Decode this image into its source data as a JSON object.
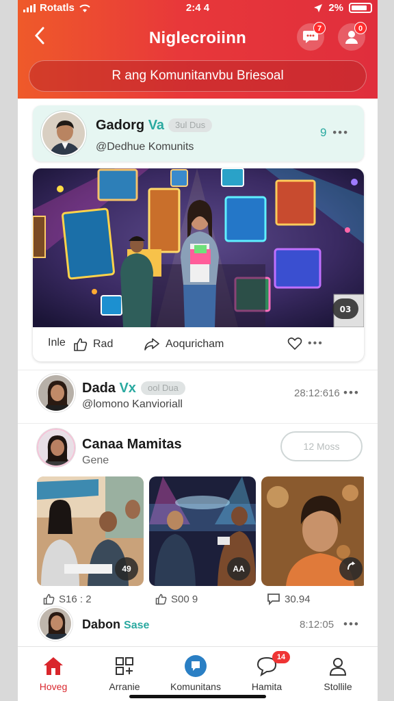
{
  "status_bar": {
    "carrier": "Rotatls",
    "time": "2:4 ​4",
    "battery_text": "2%"
  },
  "header": {
    "back_icon": "chevron-left-icon",
    "title": "Niglecroiinn",
    "chat_badge": "7",
    "profile_badge": "0",
    "search_text": "R ang Komunitanvbu Briesoal"
  },
  "feed": {
    "featured": {
      "author": "Gadorg",
      "tag": "Va",
      "pill": "3ul Dus",
      "handle": "@Dedhue Komunits",
      "meta": "9",
      "actions": {
        "first": "Inle",
        "second": "Rad",
        "third": "Aoquricham"
      },
      "image_badge": "03"
    },
    "post2": {
      "author": "Dada",
      "tag": "Vx",
      "pill": "ool Dua",
      "handle": "@lomono Kanvioriall",
      "timestamp": "28:12:616"
    },
    "post3": {
      "author": "Canaa Mamitas",
      "subtitle": "Gene",
      "follow_label": "12 Moss"
    },
    "thumbnails": [
      {
        "badge": "49",
        "meta": "S16 : 2"
      },
      {
        "badge": "AA",
        "meta": "S00 9"
      },
      {
        "badge": "",
        "meta": "30.94"
      }
    ],
    "post4": {
      "author": "Dabon",
      "tag": "Sase",
      "timestamp": "8:12:05"
    }
  },
  "bottom_nav": {
    "items": [
      {
        "label": "Hoveg",
        "icon": "home-icon"
      },
      {
        "label": "Arranie",
        "icon": "grid-icon"
      },
      {
        "label": "Komunitans",
        "icon": "community-icon"
      },
      {
        "label": "Hamita",
        "icon": "chat-icon",
        "badge": "14"
      },
      {
        "label": "Stollile",
        "icon": "profile-icon"
      }
    ]
  },
  "colors": {
    "brand_red": "#e02e3c",
    "accent_teal": "#2aa9a0",
    "active_nav": "#d9262c"
  }
}
